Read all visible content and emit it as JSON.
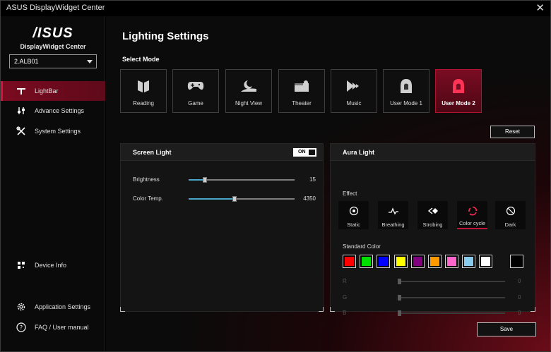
{
  "window": {
    "title": "ASUS DisplayWidget Center",
    "close_glyph": "✕"
  },
  "logo": {
    "mark": "/ISUS",
    "subtitle": "DisplayWidget Center"
  },
  "device_select": {
    "value": "2.ALB01"
  },
  "sidebar": {
    "items": [
      {
        "label": "LightBar",
        "icon": "lightbar-icon",
        "active": true
      },
      {
        "label": "Advance Settings",
        "icon": "sliders-icon",
        "active": false
      },
      {
        "label": "System Settings",
        "icon": "tools-icon",
        "active": false
      },
      {
        "label": "Device Info",
        "icon": "device-info-icon",
        "active": false
      },
      {
        "label": "Application Settings",
        "icon": "gear-icon",
        "active": false
      },
      {
        "label": "FAQ / User manual",
        "icon": "help-icon",
        "active": false
      }
    ]
  },
  "main": {
    "title": "Lighting Settings",
    "select_mode_label": "Select Mode",
    "modes": [
      {
        "label": "Reading",
        "icon": "book-icon",
        "active": false
      },
      {
        "label": "Game",
        "icon": "gamepad-icon",
        "active": false
      },
      {
        "label": "Night View",
        "icon": "moon-icon",
        "active": false
      },
      {
        "label": "Theater",
        "icon": "theater-icon",
        "active": false
      },
      {
        "label": "Music",
        "icon": "music-icon",
        "active": false
      },
      {
        "label": "User Mode 1",
        "icon": "user-icon",
        "active": false
      },
      {
        "label": "User Mode 2",
        "icon": "user-icon",
        "active": true
      }
    ],
    "reset_label": "Reset",
    "save_label": "Save"
  },
  "screen_light": {
    "title": "Screen Light",
    "toggle_label": "ON",
    "brightness": {
      "label": "Brightness",
      "value": "15",
      "fraction": 0.15
    },
    "color_temp": {
      "label": "Color Temp.",
      "value": "4350",
      "fraction": 0.43
    }
  },
  "aura_light": {
    "title": "Aura Light",
    "effect_label": "Effect",
    "effects": [
      {
        "label": "Static",
        "icon": "static-icon",
        "active": false
      },
      {
        "label": "Breathing",
        "icon": "breathing-icon",
        "active": false
      },
      {
        "label": "Strobing",
        "icon": "strobing-icon",
        "active": false
      },
      {
        "label": "Color cycle",
        "icon": "color-cycle-icon",
        "active": true
      },
      {
        "label": "Dark",
        "icon": "dark-icon",
        "active": false
      }
    ],
    "standard_color_label": "Standard Color",
    "swatches": [
      "#ff0000",
      "#00e000",
      "#0000ff",
      "#ffff00",
      "#800080",
      "#ff9900",
      "#ff66cc",
      "#88ccee",
      "#ffffff"
    ],
    "custom_swatch": "#000000",
    "rgb": [
      {
        "label": "R",
        "value": "0"
      },
      {
        "label": "G",
        "value": "0"
      },
      {
        "label": "B",
        "value": "0"
      }
    ]
  },
  "colors": {
    "accent": "#c2143a",
    "slider_fill": "#4aa7c9"
  }
}
